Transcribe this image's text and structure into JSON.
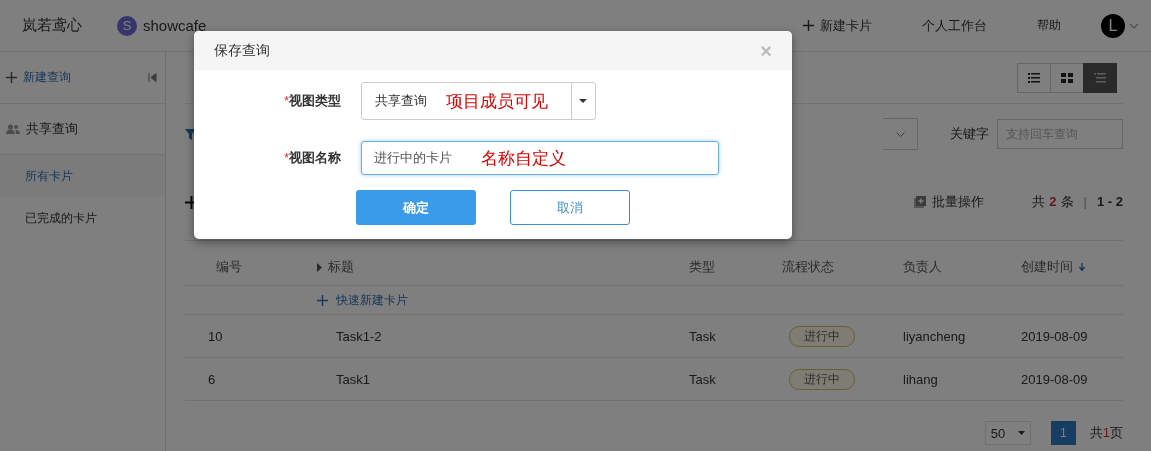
{
  "header": {
    "brand": "岚若鸢心",
    "project": {
      "initial": "S",
      "name": "showcafe"
    },
    "actions": [
      {
        "kind": "new",
        "label": "新建卡片"
      },
      {
        "kind": "link",
        "label": "个人工作台"
      },
      {
        "kind": "link",
        "label": "帮助"
      }
    ],
    "avatar": "L"
  },
  "sidebar": {
    "new_query": "新建查询",
    "group": "共享查询",
    "items": [
      {
        "label": "所有卡片",
        "selected": true
      },
      {
        "label": "已完成的卡片",
        "selected": false
      }
    ]
  },
  "view_switch": [
    {
      "kind": "list",
      "selected": false
    },
    {
      "kind": "grid",
      "selected": false
    },
    {
      "kind": "detail",
      "selected": true
    }
  ],
  "filter": {
    "keyword_label": "关键字",
    "keyword_placeholder": "支持回车查询"
  },
  "toolbar": {
    "batch": "批量操作",
    "total": {
      "prefix": "共",
      "count": "2",
      "suffix": "条"
    },
    "separator": "|",
    "range": "1 - 2"
  },
  "table": {
    "columns": [
      {
        "label": "编号"
      },
      {
        "label": "标题",
        "expander": true
      },
      {
        "label": "类型"
      },
      {
        "label": "流程状态"
      },
      {
        "label": "负责人"
      },
      {
        "label": "创建时间",
        "sort_descending": true
      }
    ],
    "quick_add": "快速新建卡片",
    "rows": [
      {
        "number": "10",
        "title": "Task1-2",
        "type": "Task",
        "status": "进行中",
        "owner": "liyancheng",
        "created": "2019-08-09"
      },
      {
        "number": "6",
        "title": "Task1",
        "type": "Task",
        "status": "进行中",
        "owner": "lihang",
        "created": "2019-08-09"
      }
    ]
  },
  "pagination": {
    "page_size": "50",
    "pages": [
      {
        "label": "1",
        "selected": true
      }
    ],
    "total": {
      "prefix": "共",
      "count": "1",
      "suffix": "页"
    }
  },
  "dialog": {
    "title": "保存查询",
    "close": "×",
    "fields": [
      {
        "kind": "select",
        "required_mark": "*",
        "label": "视图类型",
        "value": "共享查询",
        "annotation": "项目成员可见"
      },
      {
        "kind": "text",
        "required_mark": "*",
        "label": "视图名称",
        "value": "进行中的卡片",
        "focused": true,
        "annotation": "名称自定义"
      }
    ],
    "buttons": [
      {
        "kind": "primary",
        "label": "确定"
      },
      {
        "kind": "default",
        "label": "取消"
      }
    ]
  }
}
